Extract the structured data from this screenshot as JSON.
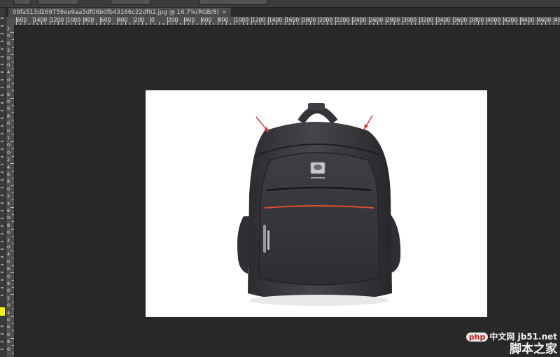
{
  "document": {
    "tab_title": "09fa513d269759ee9aa5df06b0fb43166c22df02.jpg @ 16.7%(RGB/8)",
    "close_glyph": "×"
  },
  "ruler": {
    "h_labels": [
      "600",
      "1400",
      "1200",
      "1000",
      "800",
      "600",
      "400",
      "200",
      "0",
      "200",
      "400",
      "600",
      "800",
      "1000",
      "1200",
      "1400",
      "1600",
      "1800",
      "2000",
      "2200",
      "2400",
      "2600",
      "2800",
      "3000",
      "3200",
      "3400",
      "3600",
      "3800",
      "4000",
      "4200",
      "4400",
      "4600",
      "4800"
    ],
    "v_labels": [
      "2",
      "0",
      "0",
      "2",
      "0",
      "0",
      "4",
      "0",
      "0",
      "6",
      "0",
      "0",
      "8",
      "0",
      "0",
      "1",
      "0",
      "0",
      "2",
      "4",
      "6",
      "8",
      "0",
      "2",
      "4",
      "6",
      "0",
      "8",
      "0",
      "2",
      "0",
      "4",
      "0",
      "6",
      "0",
      "8",
      "0",
      "2",
      "0",
      "4",
      "0",
      "6",
      "0",
      "8",
      "0"
    ]
  },
  "canvas": {
    "background": "#ffffff",
    "annotation_color": "#e03030",
    "accent_stripe_color": "#d8502a"
  },
  "watermark": {
    "logo_text": "php",
    "site_small": "中文网",
    "domain": "jb51.net",
    "site_big": "脚本之家"
  },
  "toolbar": {
    "foreground_color": "#f5f000"
  }
}
